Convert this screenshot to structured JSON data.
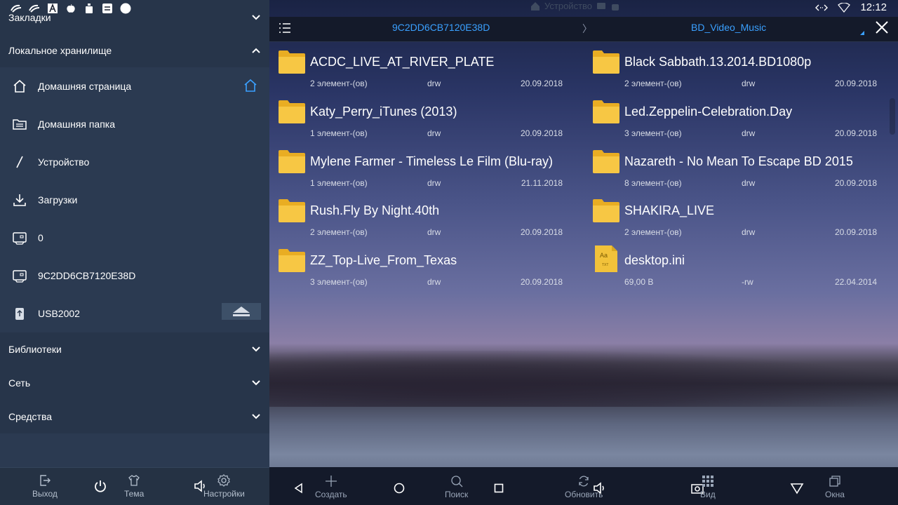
{
  "status": {
    "clock": "12:12",
    "center_label": "Устройство"
  },
  "sidebar": {
    "bookmarks": "Закладки",
    "local_storage": "Локальное хранилище",
    "items": [
      {
        "label": "Домашняя страница"
      },
      {
        "label": "Домашняя папка"
      },
      {
        "label": "Устройство"
      },
      {
        "label": "Загрузки"
      },
      {
        "label": "0"
      },
      {
        "label": "9C2DD6CB7120E38D"
      },
      {
        "label": "USB2002"
      }
    ],
    "libraries": "Библиотеки",
    "network": "Сеть",
    "tools": "Средства",
    "bottom": {
      "exit": "Выход",
      "theme": "Тема",
      "settings": "Настройки"
    }
  },
  "breadcrumb": {
    "first": "9C2DD6CB7120E38D",
    "sep": "〉",
    "second": "BD_Video_Music"
  },
  "files": [
    {
      "name": "ACDC_LIVE_AT_RIVER_PLATE",
      "count": "2 элемент-(ов)",
      "perm": "drw",
      "date": "20.09.2018"
    },
    {
      "name": "Black Sabbath.13.2014.BD1080p",
      "count": "2 элемент-(ов)",
      "perm": "drw",
      "date": "20.09.2018"
    },
    {
      "name": "Katy_Perry_iTunes (2013)",
      "count": "1 элемент-(ов)",
      "perm": "drw",
      "date": "20.09.2018"
    },
    {
      "name": "Led.Zeppelin-Celebration.Day",
      "count": "3 элемент-(ов)",
      "perm": "drw",
      "date": "20.09.2018"
    },
    {
      "name": "Mylene Farmer - Timeless Le Film (Blu-ray)",
      "count": "1 элемент-(ов)",
      "perm": "drw",
      "date": "21.11.2018"
    },
    {
      "name": "Nazareth - No Mean To Escape BD 2015",
      "count": "8 элемент-(ов)",
      "perm": "drw",
      "date": "20.09.2018"
    },
    {
      "name": "Rush.Fly By Night.40th",
      "count": "2 элемент-(ов)",
      "perm": "drw",
      "date": "20.09.2018"
    },
    {
      "name": "SHAKIRA_LIVE",
      "count": "2 элемент-(ов)",
      "perm": "drw",
      "date": "20.09.2018"
    },
    {
      "name": "ZZ_Top-Live_From_Texas",
      "count": "3 элемент-(ов)",
      "perm": "drw",
      "date": "20.09.2018"
    },
    {
      "name": "desktop.ini",
      "count": "69,00 B",
      "perm": "-rw",
      "date": "22.04.2014",
      "type": "file",
      "thumb": "Aa",
      "thumb_ext": "TXT"
    }
  ],
  "toolbar": {
    "create": "Создать",
    "search": "Поиск",
    "refresh": "Обновить",
    "view": "Вид",
    "windows": "Окна"
  },
  "colors": {
    "accent": "#3aa0ff",
    "folder": "#f5c13c",
    "sidebar": "#27354a"
  }
}
